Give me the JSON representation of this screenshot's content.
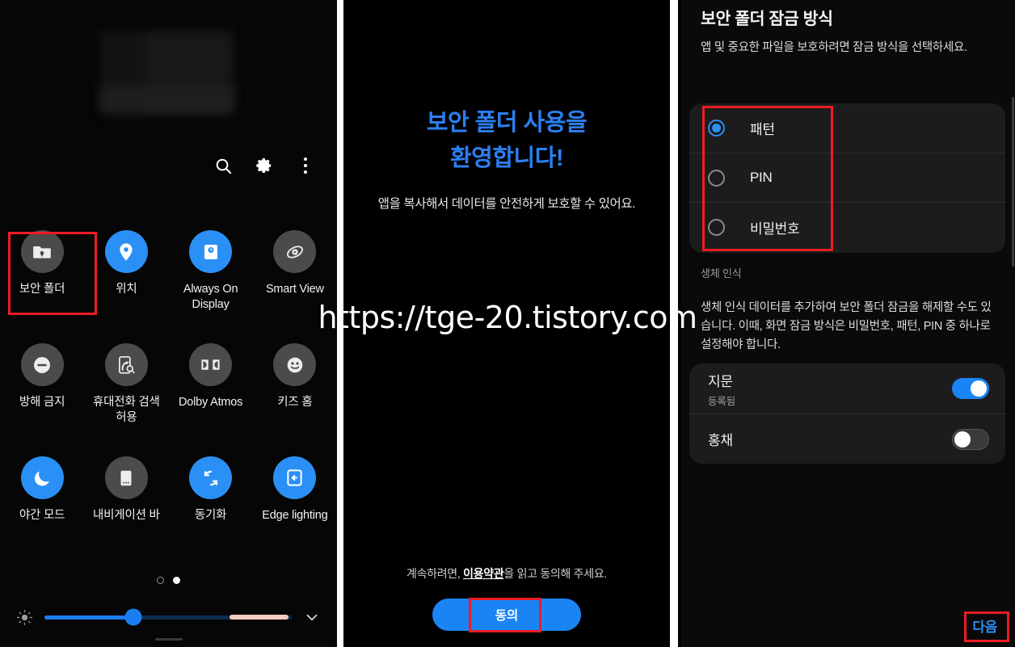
{
  "quick_settings": {
    "top_icons": [
      {
        "name": "search-icon",
        "label": "검색"
      },
      {
        "name": "gear-icon",
        "label": "설정"
      },
      {
        "name": "more-vert-icon",
        "label": "더보기"
      }
    ],
    "tiles": [
      {
        "label": "보안 폴더",
        "icon": "secure-folder-icon",
        "state": "off",
        "selected": true
      },
      {
        "label": "위치",
        "icon": "location-pin-icon",
        "state": "on",
        "selected": false
      },
      {
        "label": "Always On Display",
        "icon": "always-on-display-icon",
        "state": "on",
        "selected": false
      },
      {
        "label": "Smart View",
        "icon": "smart-view-icon",
        "state": "off",
        "selected": false
      },
      {
        "label": "방해 금지",
        "icon": "do-not-disturb-icon",
        "state": "off",
        "selected": false
      },
      {
        "label": "휴대전화 검색 허용",
        "icon": "find-my-phone-icon",
        "state": "off",
        "selected": false
      },
      {
        "label": "Dolby Atmos",
        "icon": "dolby-atmos-icon",
        "state": "off",
        "selected": false
      },
      {
        "label": "키즈 홈",
        "icon": "kids-home-icon",
        "state": "off",
        "selected": false
      },
      {
        "label": "야간 모드",
        "icon": "night-mode-icon",
        "state": "on",
        "selected": false
      },
      {
        "label": "내비게이션 바",
        "icon": "navigation-bar-icon",
        "state": "off",
        "selected": false
      },
      {
        "label": "동기화",
        "icon": "sync-icon",
        "state": "on",
        "selected": false
      },
      {
        "label": "Edge lighting",
        "icon": "edge-lighting-icon",
        "state": "on",
        "selected": false
      }
    ],
    "page_dots": {
      "count": 2,
      "active_index": 1
    },
    "brightness": {
      "icon": "brightness-icon",
      "value_percent": 36,
      "expand_icon": "chevron-down-icon"
    }
  },
  "welcome": {
    "title_line1": "보안 폴더 사용을",
    "title_line2": "환영합니다!",
    "subtitle": "앱을 복사해서 데이터를 안전하게 보호할 수 있어요.",
    "terms_prefix": "계속하려면, ",
    "terms_link": "이용약관",
    "terms_suffix": "을 읽고 동의해 주세요.",
    "agree_button": "동의"
  },
  "lock_type": {
    "title": "보안 폴더 잠금 방식",
    "description": "앱 및 중요한 파일을 보호하려면 잠금 방식을 선택하세요.",
    "options": [
      {
        "label": "패턴",
        "selected": true
      },
      {
        "label": "PIN",
        "selected": false
      },
      {
        "label": "비밀번호",
        "selected": false
      }
    ],
    "biometrics_header": "생체 인식",
    "biometrics_description": "생체 인식 데이터를 추가하여 보안 폴더 잠금을 해제할 수도 있습니다. 이때, 화면 잠금 방식은 비밀번호, 패턴, PIN 중 하나로 설정해야 합니다.",
    "biometrics_rows": [
      {
        "title": "지문",
        "subtitle": "등록됨",
        "toggle": "on"
      },
      {
        "title": "홍채",
        "subtitle": "",
        "toggle": "off"
      }
    ],
    "next_button": "다음"
  },
  "watermark": {
    "text": "https://tge-20.tistory.com"
  },
  "colors": {
    "accent_blue": "#1a84f5",
    "tile_on": "#2a90f5",
    "tile_off": "#4b4b4b",
    "highlight_red": "#ee1c24",
    "card_bg": "#1c1c1c"
  }
}
